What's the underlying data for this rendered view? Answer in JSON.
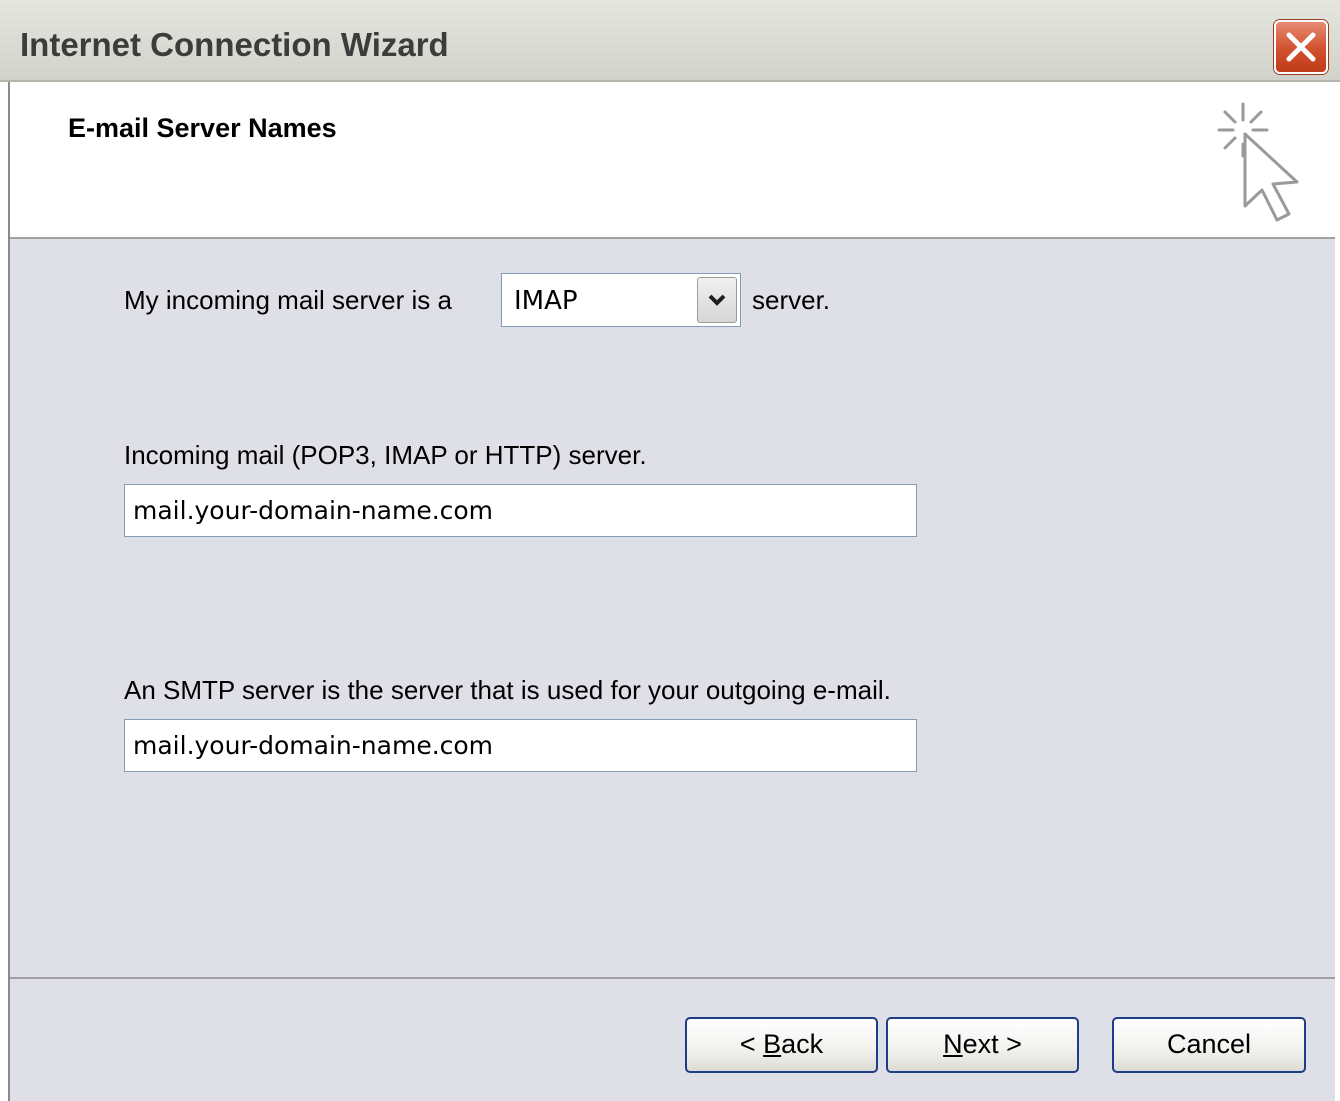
{
  "window": {
    "title": "Internet Connection Wizard"
  },
  "header": {
    "title": "E-mail Server Names",
    "icon": "wizard-cursor-sparkle-icon"
  },
  "form": {
    "server_type_prefix": "My incoming mail server is a",
    "server_type_value": "IMAP",
    "server_type_suffix": "server.",
    "incoming_label": "Incoming mail (POP3, IMAP or HTTP) server.",
    "incoming_value": "mail.your-domain-name.com",
    "smtp_label": "An SMTP server is the server that is used for your outgoing e-mail.",
    "smtp_value": "mail.your-domain-name.com"
  },
  "buttons": {
    "back_prefix": "< ",
    "back_mnemonic": "B",
    "back_rest": "ack",
    "next_mnemonic": "N",
    "next_rest": "ext >",
    "cancel": "Cancel"
  },
  "colors": {
    "dialog_background": "#dfe0e7",
    "close_button": "#d1502d",
    "button_border": "#1f3c88"
  }
}
